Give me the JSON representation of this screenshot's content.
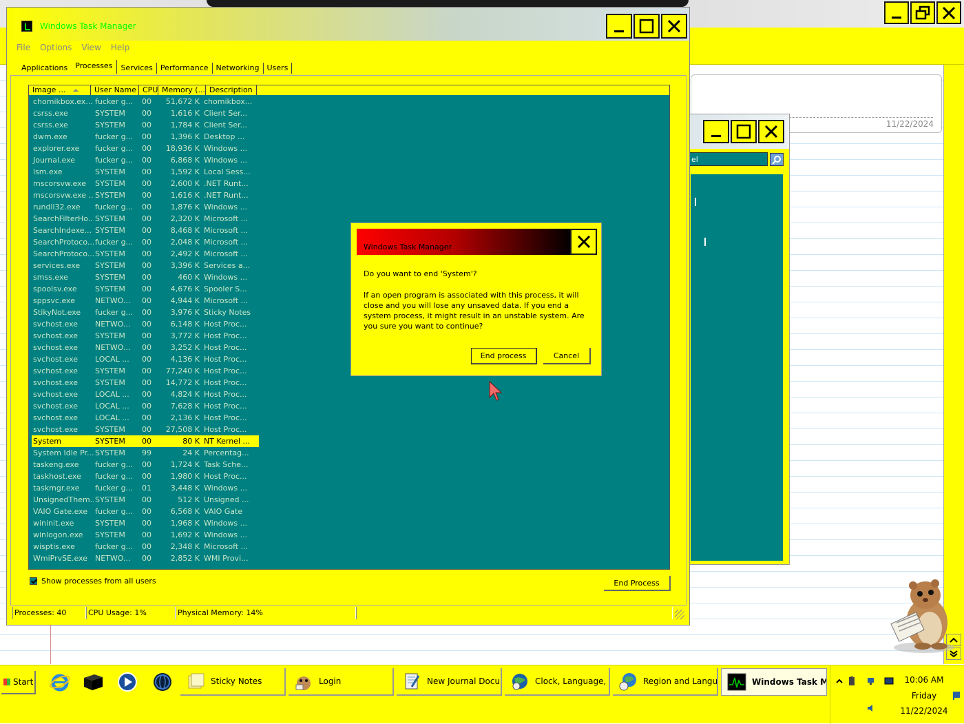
{
  "taskmgr": {
    "title": "Windows Task Manager",
    "menu": [
      "File",
      "Options",
      "View",
      "Help"
    ],
    "tabs": [
      "Applications",
      "Processes",
      "Services",
      "Performance",
      "Networking",
      "Users"
    ],
    "active_tab": "Processes",
    "columns": [
      "Image ...",
      "User Name",
      "CPU",
      "Memory (...",
      "Description"
    ],
    "rows": [
      [
        "chomikbox.ex...",
        "fucker g...",
        "00",
        "51,672 K",
        "chomikbox..."
      ],
      [
        "csrss.exe",
        "SYSTEM",
        "00",
        "1,616 K",
        "Client Ser..."
      ],
      [
        "csrss.exe",
        "SYSTEM",
        "00",
        "1,784 K",
        "Client Ser..."
      ],
      [
        "dwm.exe",
        "fucker g...",
        "00",
        "1,396 K",
        "Desktop ..."
      ],
      [
        "explorer.exe",
        "fucker g...",
        "00",
        "18,936 K",
        "Windows ..."
      ],
      [
        "Journal.exe",
        "fucker g...",
        "00",
        "6,868 K",
        "Windows ..."
      ],
      [
        "lsm.exe",
        "SYSTEM",
        "00",
        "1,592 K",
        "Local Sess..."
      ],
      [
        "mscorsvw.exe",
        "SYSTEM",
        "00",
        "2,600 K",
        ".NET Runt..."
      ],
      [
        "mscorsvw.exe ...",
        "SYSTEM",
        "00",
        "1,616 K",
        ".NET Runt..."
      ],
      [
        "rundll32.exe",
        "fucker g...",
        "00",
        "1,876 K",
        "Windows ..."
      ],
      [
        "SearchFilterHo...",
        "SYSTEM",
        "00",
        "2,320 K",
        "Microsoft ..."
      ],
      [
        "SearchIndexe...",
        "SYSTEM",
        "00",
        "8,468 K",
        "Microsoft ..."
      ],
      [
        "SearchProtoco...",
        "fucker g...",
        "00",
        "2,048 K",
        "Microsoft ..."
      ],
      [
        "SearchProtoco...",
        "SYSTEM",
        "00",
        "2,492 K",
        "Microsoft ..."
      ],
      [
        "services.exe",
        "SYSTEM",
        "00",
        "3,396 K",
        "Services a..."
      ],
      [
        "smss.exe",
        "SYSTEM",
        "00",
        "460 K",
        "Windows ..."
      ],
      [
        "spoolsv.exe",
        "SYSTEM",
        "00",
        "4,676 K",
        "Spooler S..."
      ],
      [
        "sppsvc.exe",
        "NETWO...",
        "00",
        "4,944 K",
        "Microsoft ..."
      ],
      [
        "StikyNot.exe",
        "fucker g...",
        "00",
        "3,976 K",
        "Sticky Notes"
      ],
      [
        "svchost.exe",
        "NETWO...",
        "00",
        "6,148 K",
        "Host Proc..."
      ],
      [
        "svchost.exe",
        "SYSTEM",
        "00",
        "3,772 K",
        "Host Proc..."
      ],
      [
        "svchost.exe",
        "NETWO...",
        "00",
        "3,252 K",
        "Host Proc..."
      ],
      [
        "svchost.exe",
        "LOCAL ...",
        "00",
        "4,136 K",
        "Host Proc..."
      ],
      [
        "svchost.exe",
        "SYSTEM",
        "00",
        "77,240 K",
        "Host Proc..."
      ],
      [
        "svchost.exe",
        "SYSTEM",
        "00",
        "14,772 K",
        "Host Proc..."
      ],
      [
        "svchost.exe",
        "LOCAL ...",
        "00",
        "4,824 K",
        "Host Proc..."
      ],
      [
        "svchost.exe",
        "LOCAL ...",
        "00",
        "7,628 K",
        "Host Proc..."
      ],
      [
        "svchost.exe",
        "LOCAL ...",
        "00",
        "2,136 K",
        "Host Proc..."
      ],
      [
        "svchost.exe",
        "SYSTEM",
        "00",
        "27,508 K",
        "Host Proc..."
      ],
      [
        "System",
        "SYSTEM",
        "00",
        "80 K",
        "NT Kernel ..."
      ],
      [
        "System Idle Pr...",
        "SYSTEM",
        "99",
        "24 K",
        "Percentag..."
      ],
      [
        "taskeng.exe",
        "fucker g...",
        "00",
        "1,724 K",
        "Task Sche..."
      ],
      [
        "taskhost.exe",
        "fucker g...",
        "00",
        "1,980 K",
        "Host Proc..."
      ],
      [
        "taskmgr.exe",
        "fucker g...",
        "01",
        "3,448 K",
        "Windows ..."
      ],
      [
        "UnsignedThem...",
        "SYSTEM",
        "00",
        "512 K",
        "Unsigned ..."
      ],
      [
        "VAIO Gate.exe",
        "fucker g...",
        "00",
        "6,568 K",
        "VAIO Gate"
      ],
      [
        "wininit.exe",
        "SYSTEM",
        "00",
        "1,968 K",
        "Windows ..."
      ],
      [
        "winlogon.exe",
        "SYSTEM",
        "00",
        "1,692 K",
        "Windows ..."
      ],
      [
        "wisptis.exe",
        "fucker g...",
        "00",
        "2,348 K",
        "Microsoft ..."
      ],
      [
        "WmiPrvSE.exe",
        "NETWO...",
        "00",
        "2,852 K",
        "WMI Provi..."
      ]
    ],
    "selected_index": 29,
    "show_all_label": "Show processes from all users",
    "end_process_label": "End Process",
    "status": {
      "processes": "Processes: 40",
      "cpu": "CPU Usage: 1%",
      "memory": "Physical Memory: 14%"
    }
  },
  "dialog": {
    "title": "Windows Task Manager",
    "question": "Do you want to end 'System'?",
    "message": "If an open program is associated with this process, it will close and you will lose any unsaved data. If you end a system process, it might result in an unstable system. Are you sure you want to continue?",
    "confirm_label": "End process",
    "cancel_label": "Cancel"
  },
  "journal": {
    "date": "11/22/2024"
  },
  "search_window": {
    "search_value": "el"
  },
  "taskbar": {
    "start_label": "Start",
    "buttons": [
      "Sticky Notes",
      "Login",
      "New Journal Docu...",
      "Clock, Language, a...",
      "Region and Langua...",
      "Windows Task Ma..."
    ],
    "active_button": "Windows Task Ma...",
    "clock": {
      "time": "10:06 AM",
      "day": "Friday",
      "date": "11/22/2024"
    }
  },
  "colors": {
    "theme": "#ffff00",
    "list_bg": "#008080",
    "title_text": "#00ff00",
    "dialog_title_start": "#ff0000"
  }
}
